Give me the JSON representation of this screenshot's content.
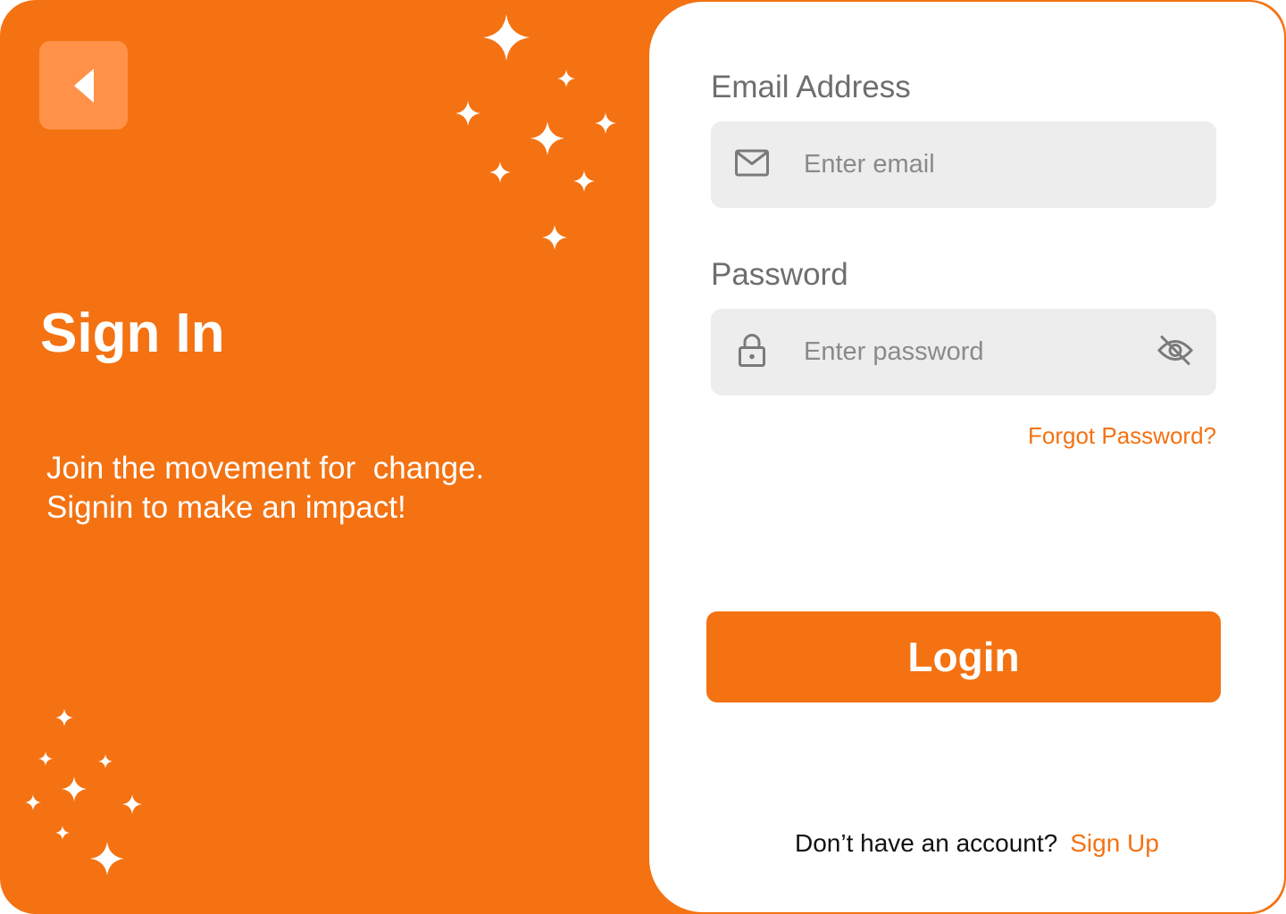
{
  "colors": {
    "accent": "#F47212",
    "back_button_bg": "#FF9248",
    "input_bg": "#EDEDED",
    "label_text": "#6E6E6E"
  },
  "hero": {
    "title": "Sign In",
    "subtitle": "Join the movement for  change.\nSignin to make an impact!"
  },
  "back_button": {
    "icon": "caret-left-icon"
  },
  "email": {
    "label": "Email Address",
    "placeholder": "Enter email",
    "value": "",
    "icon": "mail-icon"
  },
  "password": {
    "label": "Password",
    "placeholder": "Enter password",
    "value": "",
    "icon": "lock-icon",
    "toggle_icon": "eye-off-icon"
  },
  "forgot_password": "Forgot Password?",
  "login_button": "Login",
  "signup": {
    "prompt": "Don’t have an account?",
    "link": "Sign Up"
  },
  "decorations": {
    "icon": "sparkle-icon"
  }
}
